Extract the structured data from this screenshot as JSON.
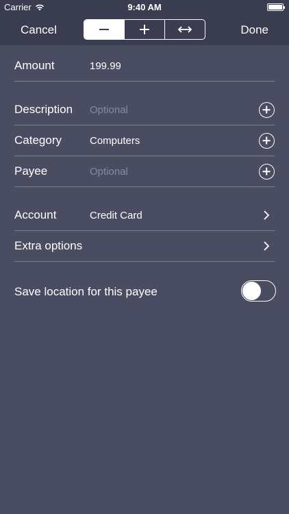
{
  "status": {
    "carrier": "Carrier",
    "time": "9:40 AM"
  },
  "nav": {
    "cancel": "Cancel",
    "done": "Done",
    "segments": [
      "minus-icon",
      "plus-icon",
      "left-right-arrow-icon"
    ],
    "selected_segment": 0
  },
  "form": {
    "amount": {
      "label": "Amount",
      "value": "199.99"
    },
    "description": {
      "label": "Description",
      "placeholder": "Optional"
    },
    "category": {
      "label": "Category",
      "value": "Computers"
    },
    "payee": {
      "label": "Payee",
      "placeholder": "Optional"
    },
    "account": {
      "label": "Account",
      "value": "Credit Card"
    },
    "extra": {
      "label": "Extra options"
    },
    "save_location": {
      "label": "Save location for this payee",
      "enabled": false
    }
  },
  "colors": {
    "background": "#4a4d62",
    "bar": "#3a3d50",
    "separator": "#7a7d90",
    "placeholder": "#868a9e"
  }
}
